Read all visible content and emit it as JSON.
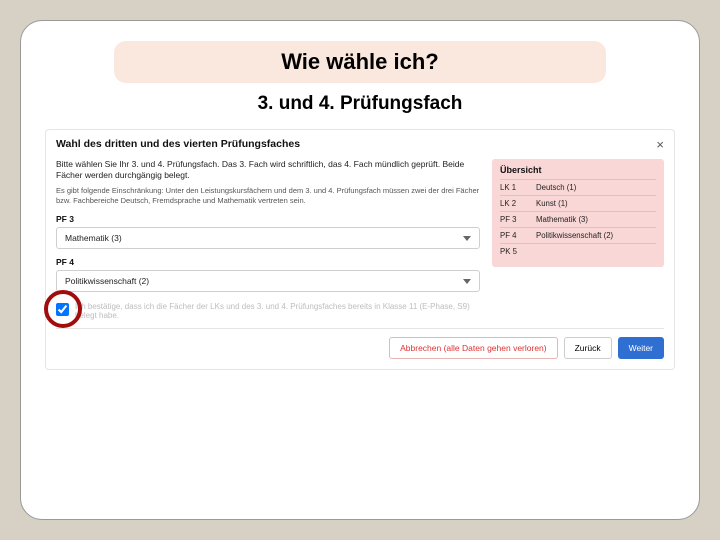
{
  "title": "Wie wähle ich?",
  "subtitle": "3. und 4. Prüfungsfach",
  "panel": {
    "heading": "Wahl des dritten und des vierten Prüfungsfaches",
    "instructions": "Bitte wählen Sie Ihr 3. und 4. Prüfungsfach. Das 3. Fach wird schriftlich, das 4. Fach mündlich geprüft. Beide Fächer werden durchgängig belegt.",
    "note": "Es gibt folgende Einschränkung: Unter den Leistungskursfächern und dem 3. und 4. Prüfungsfach müssen zwei der drei Fächer bzw. Fachbereiche Deutsch, Fremdsprache und Mathematik vertreten sein.",
    "pf3_label": "PF 3",
    "pf3_value": "Mathematik (3)",
    "pf4_label": "PF 4",
    "pf4_value": "Politikwissenschaft (2)",
    "confirm_text": "Ich bestätige, dass ich die Fächer der LKs und des 3. und 4. Prüfungsfaches bereits in Klasse 11 (E-Phase, S9) belegt habe.",
    "close_glyph": "×"
  },
  "overview": {
    "title": "Übersicht",
    "rows": [
      {
        "key": "LK 1",
        "val": "Deutsch (1)"
      },
      {
        "key": "LK 2",
        "val": "Kunst (1)"
      },
      {
        "key": "PF 3",
        "val": "Mathematik (3)"
      },
      {
        "key": "PF 4",
        "val": "Politikwissenschaft (2)"
      },
      {
        "key": "PK 5",
        "val": ""
      }
    ]
  },
  "buttons": {
    "cancel": "Abbrechen (alle Daten gehen verloren)",
    "back": "Zurück",
    "next": "Weiter"
  }
}
